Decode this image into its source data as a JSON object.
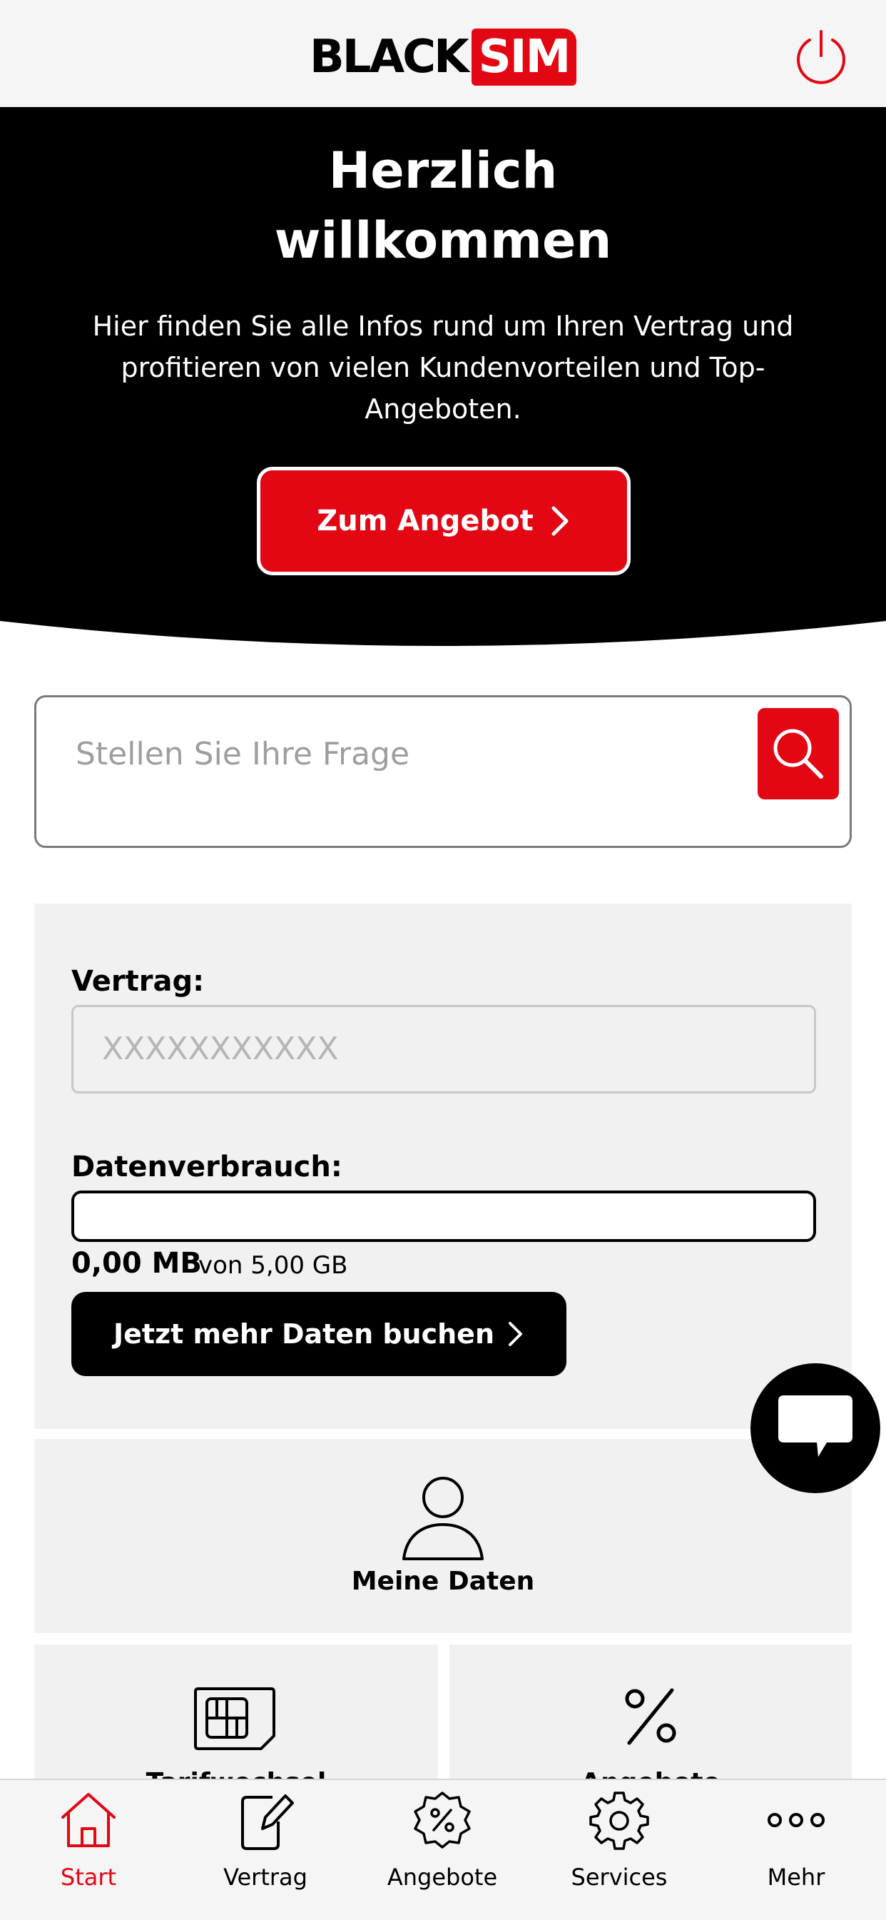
{
  "header": {
    "logo_black": "BLACK",
    "logo_sim": "SIM",
    "power_icon": "power-icon"
  },
  "hero": {
    "title_line1": "Herzlich",
    "title_line2": "willkommen",
    "subtitle": "Hier finden Sie alle Infos rund um Ihren Vertrag und profitieren von vielen Kundenvorteilen und Top-Angeboten.",
    "cta_label": "Zum Angebot"
  },
  "search": {
    "placeholder": "Stellen Sie Ihre Frage",
    "icon": "search-icon"
  },
  "contract": {
    "label": "Vertrag:",
    "value": "XXXXXXXXXXX",
    "usage_label": "Datenverbrauch:",
    "used": "0,00 MB",
    "total": "von 5,00 GB",
    "usage_fraction": 0,
    "buy_label": "Jetzt mehr Daten buchen"
  },
  "tiles": {
    "my_data": "Meine Daten",
    "tariff_label": "Tarifwechsel",
    "offers_label": "Angebote"
  },
  "bottom_nav": [
    {
      "label": "Start",
      "icon": "home-icon",
      "active": true
    },
    {
      "label": "Vertrag",
      "icon": "contract-edit-icon",
      "active": false
    },
    {
      "label": "Angebote",
      "icon": "percent-badge-icon",
      "active": false
    },
    {
      "label": "Services",
      "icon": "gear-icon",
      "active": false
    },
    {
      "label": "Mehr",
      "icon": "more-dots-icon",
      "active": false
    }
  ],
  "colors": {
    "brand_red": "#e30613",
    "hero_bg": "#000000",
    "panel_bg": "#f1f1f1"
  }
}
